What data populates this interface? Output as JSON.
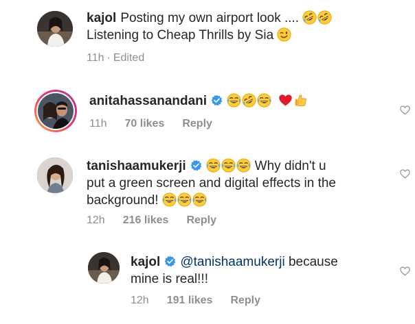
{
  "comments": [
    {
      "username": "kajol",
      "text_line1": "Posting my own airport look ....",
      "text_line2": "Listening to Cheap Thrills by Sia",
      "time": "11h",
      "separator": "·",
      "edited": "Edited"
    },
    {
      "username": "anitahassanandani",
      "time": "11h",
      "likes": "70 likes",
      "reply": "Reply"
    },
    {
      "username": "tanishaamukerji",
      "text_line1": "Why didn't u",
      "text_line2": "put a green screen and digital effects in the",
      "text_line3": "background!",
      "time": "12h",
      "likes": "216 likes",
      "reply": "Reply"
    },
    {
      "username": "kajol",
      "mention": "@tanishaamukerji",
      "text_line1": "because",
      "text_line2": "mine is real!!!",
      "time": "12h",
      "likes": "191 likes",
      "reply": "Reply"
    }
  ],
  "colors": {
    "verified": "#3897f0",
    "meta": "#8e8e8e",
    "mention": "#003569",
    "text": "#262626"
  }
}
